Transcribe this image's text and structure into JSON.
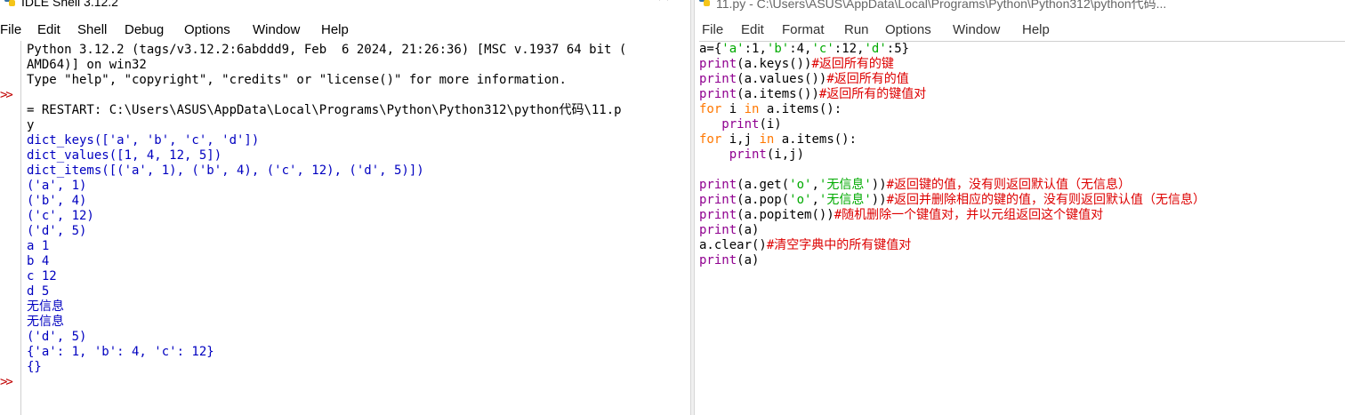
{
  "shell": {
    "title": "IDLE Shell 3.12.2",
    "menu": [
      "File",
      "Edit",
      "Shell",
      "Debug",
      "Options",
      "Window",
      "Help"
    ],
    "prompt_symbol": ">>",
    "lines": [
      {
        "text": "Python 3.12.2 (tags/v3.12.2:6abddd9, Feb  6 2024, 21:26:36) [MSC v.1937 64 bit (",
        "style": "plain"
      },
      {
        "text": "AMD64)] on win32",
        "style": "plain"
      },
      {
        "text": "Type \"help\", \"copyright\", \"credits\" or \"license()\" for more information.",
        "style": "plain"
      },
      {
        "text": "",
        "style": "plain"
      },
      {
        "text": "= RESTART: C:\\Users\\ASUS\\AppData\\Local\\Programs\\Python\\Python312\\python代码\\11.p",
        "style": "plain"
      },
      {
        "text": "y",
        "style": "plain"
      },
      {
        "text": "dict_keys(['a', 'b', 'c', 'd'])",
        "style": "stdout"
      },
      {
        "text": "dict_values([1, 4, 12, 5])",
        "style": "stdout"
      },
      {
        "text": "dict_items([('a', 1), ('b', 4), ('c', 12), ('d', 5)])",
        "style": "stdout"
      },
      {
        "text": "('a', 1)",
        "style": "stdout"
      },
      {
        "text": "('b', 4)",
        "style": "stdout"
      },
      {
        "text": "('c', 12)",
        "style": "stdout"
      },
      {
        "text": "('d', 5)",
        "style": "stdout"
      },
      {
        "text": "a 1",
        "style": "stdout"
      },
      {
        "text": "b 4",
        "style": "stdout"
      },
      {
        "text": "c 12",
        "style": "stdout"
      },
      {
        "text": "d 5",
        "style": "stdout"
      },
      {
        "text": "无信息",
        "style": "stdout"
      },
      {
        "text": "无信息",
        "style": "stdout"
      },
      {
        "text": "('d', 5)",
        "style": "stdout"
      },
      {
        "text": "{'a': 1, 'b': 4, 'c': 12}",
        "style": "stdout"
      },
      {
        "text": "{}",
        "style": "stdout"
      }
    ]
  },
  "editor": {
    "title": "11.py - C:\\Users\\ASUS\\AppData\\Local\\Programs\\Python\\Python312\\python代码...",
    "menu": [
      "File",
      "Edit",
      "Format",
      "Run",
      "Options",
      "Window",
      "Help"
    ],
    "lines": [
      [
        [
          "a={",
          "plain"
        ],
        [
          "'a'",
          "str"
        ],
        [
          ":1,",
          "plain"
        ],
        [
          "'b'",
          "str"
        ],
        [
          ":4,",
          "plain"
        ],
        [
          "'c'",
          "str"
        ],
        [
          ":12,",
          "plain"
        ],
        [
          "'d'",
          "str"
        ],
        [
          ":5}",
          "plain"
        ]
      ],
      [
        [
          "print",
          "bi"
        ],
        [
          "(a.keys())",
          "plain"
        ],
        [
          "#返回所有的键",
          "cm"
        ]
      ],
      [
        [
          "print",
          "bi"
        ],
        [
          "(a.values())",
          "plain"
        ],
        [
          "#返回所有的值",
          "cm"
        ]
      ],
      [
        [
          "print",
          "bi"
        ],
        [
          "(a.items())",
          "plain"
        ],
        [
          "#返回所有的键值对",
          "cm"
        ]
      ],
      [
        [
          "for",
          "kw"
        ],
        [
          " i ",
          "plain"
        ],
        [
          "in",
          "kw"
        ],
        [
          " a.items():",
          "plain"
        ]
      ],
      [
        [
          "   ",
          "plain"
        ],
        [
          "print",
          "bi"
        ],
        [
          "(i)",
          "plain"
        ]
      ],
      [
        [
          "for",
          "kw"
        ],
        [
          " i,j ",
          "plain"
        ],
        [
          "in",
          "kw"
        ],
        [
          " a.items():",
          "plain"
        ]
      ],
      [
        [
          "    ",
          "plain"
        ],
        [
          "print",
          "bi"
        ],
        [
          "(i,j)",
          "plain"
        ]
      ],
      [],
      [
        [
          "print",
          "bi"
        ],
        [
          "(a.get(",
          "plain"
        ],
        [
          "'o'",
          "str"
        ],
        [
          ",",
          "plain"
        ],
        [
          "'无信息'",
          "str"
        ],
        [
          "))",
          "plain"
        ],
        [
          "#返回键的值，没有则返回默认值（无信息）",
          "cm"
        ]
      ],
      [
        [
          "print",
          "bi"
        ],
        [
          "(a.pop(",
          "plain"
        ],
        [
          "'o'",
          "str"
        ],
        [
          ",",
          "plain"
        ],
        [
          "'无信息'",
          "str"
        ],
        [
          "))",
          "plain"
        ],
        [
          "#返回并删除相应的键的值，没有则返回默认值（无信息）",
          "cm"
        ]
      ],
      [
        [
          "print",
          "bi"
        ],
        [
          "(a.popitem())",
          "plain"
        ],
        [
          "#随机删除一个键值对，并以元组返回这个键值对",
          "cm"
        ]
      ],
      [
        [
          "print",
          "bi"
        ],
        [
          "(a)",
          "plain"
        ]
      ],
      [
        [
          "a.clear()",
          "plain"
        ],
        [
          "#清空字典中的所有键值对",
          "cm"
        ]
      ],
      [
        [
          "print",
          "bi"
        ],
        [
          "(a)",
          "plain"
        ]
      ]
    ]
  }
}
